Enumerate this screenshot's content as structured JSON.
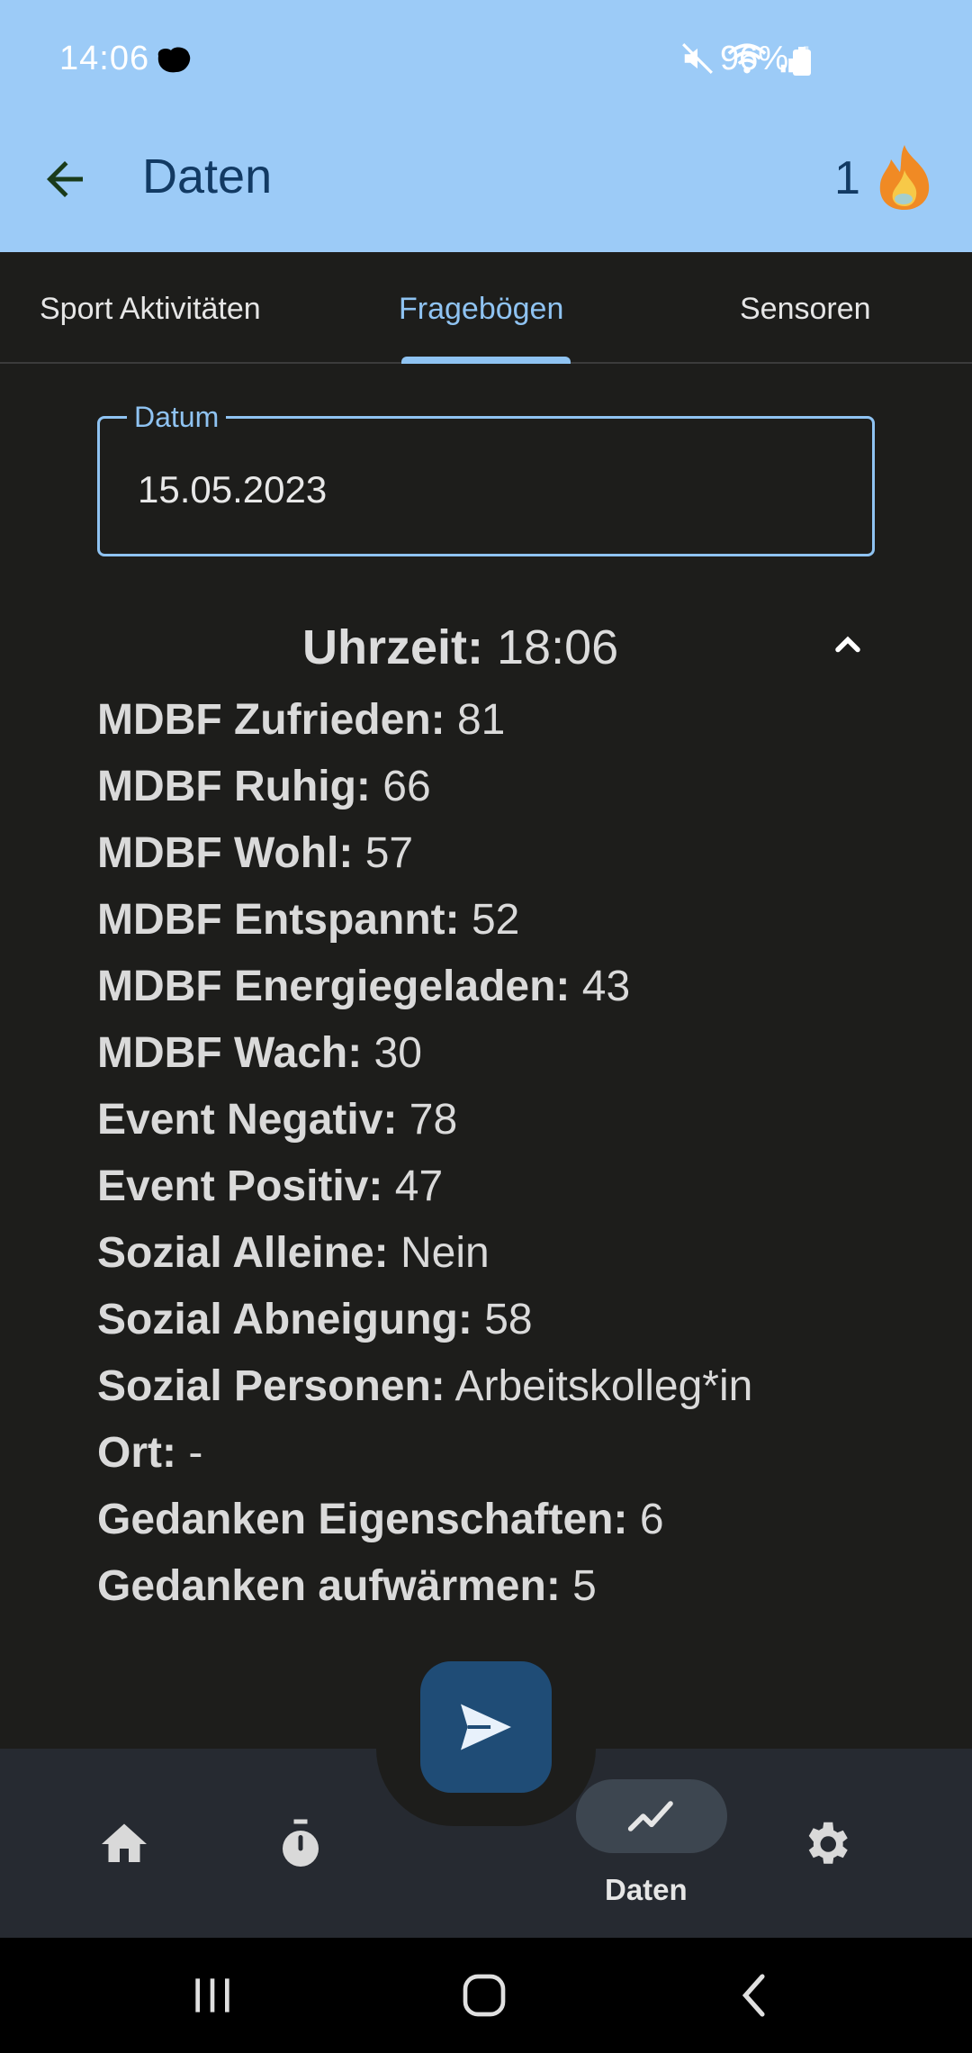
{
  "status_bar": {
    "time": "14:06",
    "battery": "96%"
  },
  "app_bar": {
    "title": "Daten",
    "streak_count": "1"
  },
  "tabs": [
    {
      "label": "Sport Aktivitäten",
      "active": false
    },
    {
      "label": "Fragebögen",
      "active": true
    },
    {
      "label": "Sensoren",
      "active": false
    }
  ],
  "date_field": {
    "label": "Datum",
    "value": "15.05.2023"
  },
  "entry": {
    "time_label": "Uhrzeit:",
    "time_value": "18:06",
    "rows": [
      {
        "key": "MDBF Zufrieden:",
        "value": "81"
      },
      {
        "key": "MDBF Ruhig:",
        "value": "66"
      },
      {
        "key": "MDBF Wohl:",
        "value": "57"
      },
      {
        "key": "MDBF Entspannt:",
        "value": "52"
      },
      {
        "key": "MDBF Energiegeladen:",
        "value": "43"
      },
      {
        "key": "MDBF Wach:",
        "value": "30"
      },
      {
        "key": "Event Negativ:",
        "value": "78"
      },
      {
        "key": "Event Positiv:",
        "value": "47"
      },
      {
        "key": "Sozial Alleine:",
        "value": "Nein"
      },
      {
        "key": "Sozial Abneigung:",
        "value": "58"
      },
      {
        "key": "Sozial Personen:",
        "value": "Arbeitskolleg*in"
      },
      {
        "key": "Ort:",
        "value": "-"
      },
      {
        "key": "Gedanken Eigenschaften:",
        "value": "6"
      },
      {
        "key": "Gedanken aufwärmen:",
        "value": "5"
      }
    ]
  },
  "bottom_nav": {
    "active_label": "Daten",
    "items": [
      "home-icon",
      "timer-icon",
      "chart-icon",
      "settings-icon"
    ]
  },
  "colors": {
    "app_bar": "#9ccbf7",
    "accent": "#8fc3f2",
    "background": "#1d1d1b",
    "fab": "#1f4c76",
    "nav_bg": "#262a31"
  }
}
